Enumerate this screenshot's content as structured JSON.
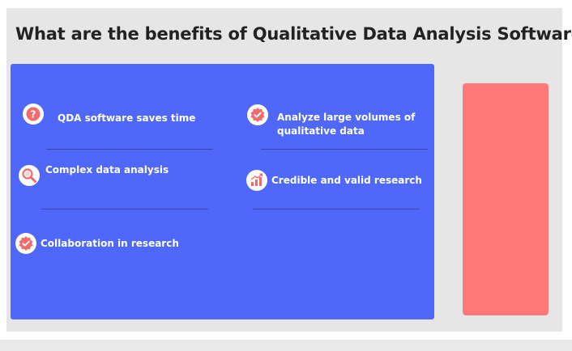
{
  "title": "What are the benefits of Qualitative Data Analysis Software?",
  "benefits": [
    {
      "label": "QDA software saves time",
      "icon": "question-icon"
    },
    {
      "label": "Analyze large volumes of",
      "label_line2": "qualitative data",
      "icon": "check-badge-icon"
    },
    {
      "label": "Complex data analysis",
      "icon": "magnifier-icon"
    },
    {
      "label": "Credible and valid research",
      "icon": "bar-chart-icon"
    },
    {
      "label": "Collaboration in research",
      "icon": "check-badge-icon"
    }
  ],
  "colors": {
    "panel": "#5068fa",
    "side_panel": "#ff7979",
    "icon_accent": "#f26b6b",
    "background": "#e6e6e6"
  }
}
